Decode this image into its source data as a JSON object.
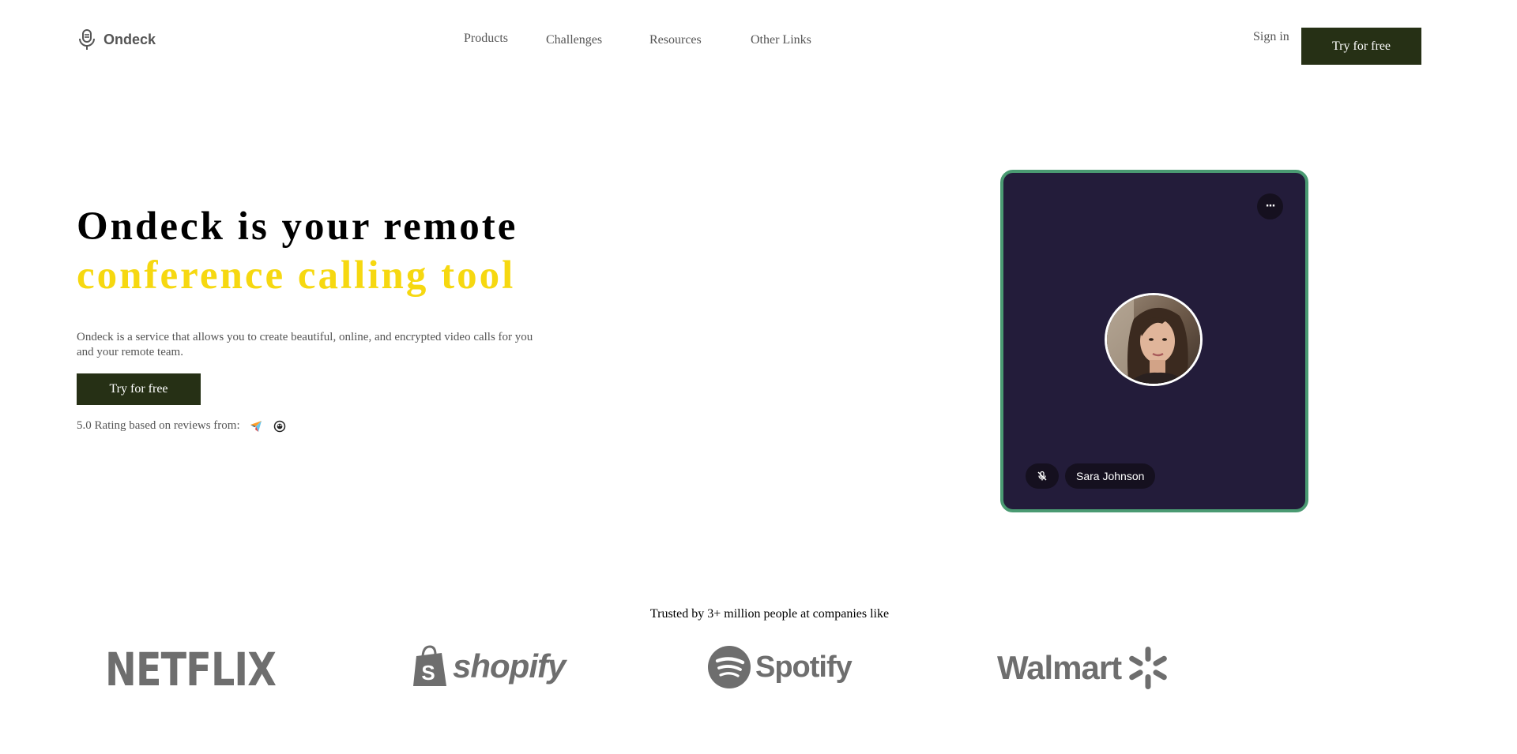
{
  "header": {
    "logo_text": "Ondeck",
    "logo_icon": "microphone-icon",
    "nav": [
      "Products",
      "Challenges",
      "Resources",
      "Other Links"
    ],
    "sign_in": "Sign in",
    "cta": "Try for free"
  },
  "hero": {
    "title_line1": "Ondeck is your remote",
    "title_line2": "conference calling tool",
    "description": "Ondeck is a service that allows you to create beautiful, online, and encrypted video calls for you and your remote team.",
    "cta": "Try for free",
    "rating_text": "5.0 Rating based on reviews from:",
    "rating_icons": [
      "capterra-icon",
      "producthunt-icon"
    ]
  },
  "call_card": {
    "more_label": "···",
    "participant_name": "Sara Johnson",
    "mute_icon": "microphone-off-icon"
  },
  "trusted": {
    "text": "Trusted by 3+ million people at companies like",
    "brands": [
      "NETFLIX",
      "shopify",
      "Spotify",
      "Walmart"
    ]
  },
  "colors": {
    "accent_dark": "#263015",
    "accent_yellow": "#f6d810",
    "card_bg": "#231c3a",
    "card_border": "#4a9a72"
  }
}
